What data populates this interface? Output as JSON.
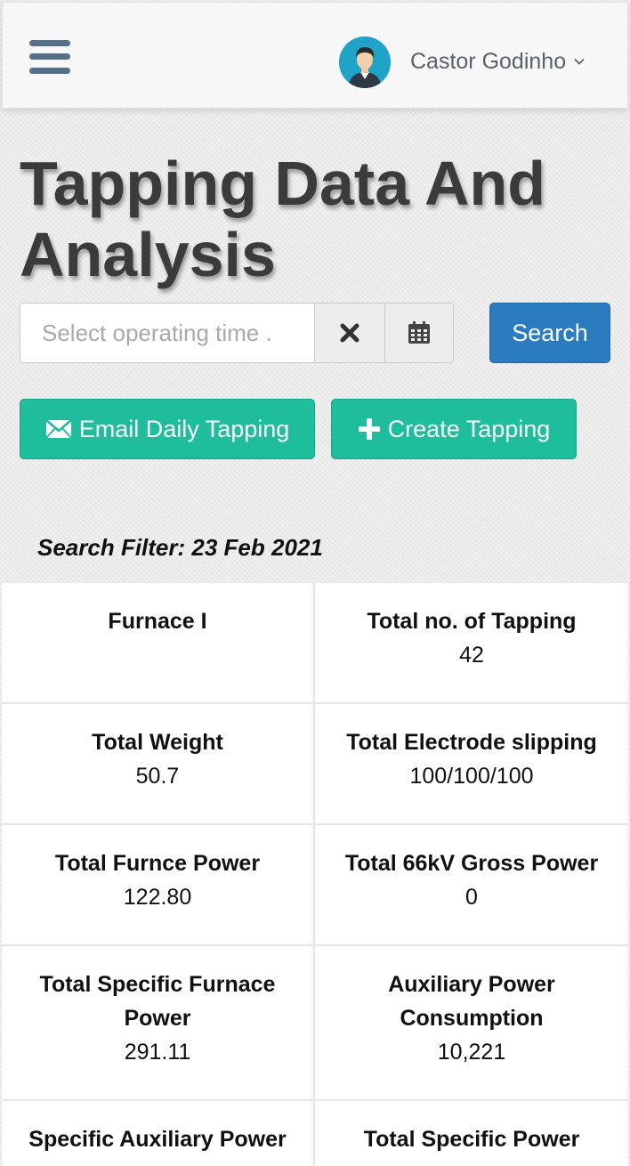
{
  "header": {
    "menu_icon": "hamburger-menu-icon",
    "user_name": "Castor Godinho",
    "avatar_icon": "user-avatar-icon"
  },
  "page": {
    "title": "Tapping Data And Analysis"
  },
  "search": {
    "placeholder": "Select operating time .",
    "clear_icon": "close-icon",
    "calendar_icon": "calendar-icon",
    "button_label": "Search"
  },
  "actions": {
    "email_label": "Email Daily Tapping",
    "email_icon": "envelope-icon",
    "create_label": "Create Tapping",
    "create_icon": "plus-icon"
  },
  "filter": {
    "text": "Search Filter: 23 Feb 2021"
  },
  "stats": [
    {
      "label": "Furnace I",
      "value": ""
    },
    {
      "label": "Total no. of Tapping",
      "value": "42"
    },
    {
      "label": "Total Weight",
      "value": "50.7"
    },
    {
      "label": "Total Electrode slipping",
      "value": "100/100/100"
    },
    {
      "label": "Total Furnce Power",
      "value": "122.80"
    },
    {
      "label": "Total 66kV Gross Power",
      "value": "0"
    },
    {
      "label": "Total Specific Furnace Power",
      "value": "291.11"
    },
    {
      "label": "Auxiliary Power Consumption",
      "value": "10,221"
    },
    {
      "label": "Specific Auxiliary Power",
      "value": ""
    },
    {
      "label": "Total Specific Power",
      "value": ""
    }
  ],
  "colors": {
    "primary": "#2a7bc0",
    "success": "#1ebd9c",
    "menu": "#56708a",
    "avatar_bg": "#1fa3c8"
  }
}
